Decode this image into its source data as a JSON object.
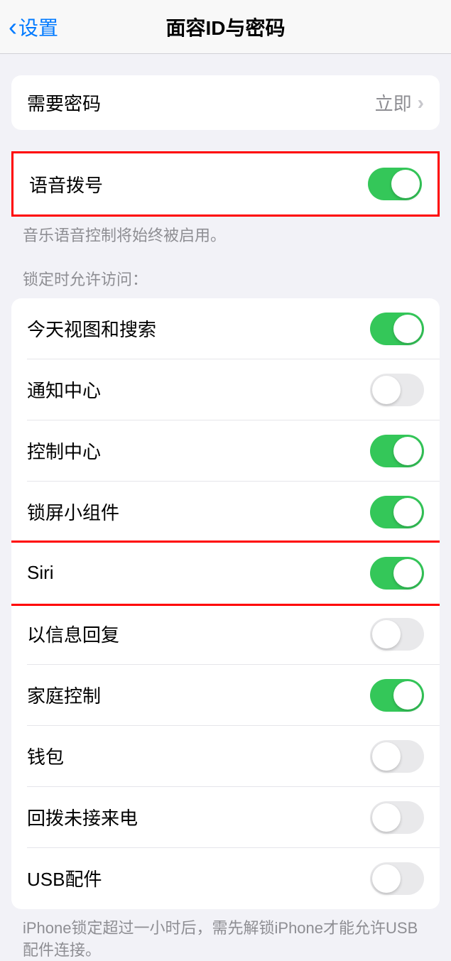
{
  "nav": {
    "back_label": "设置",
    "title": "面容ID与密码"
  },
  "passcode": {
    "require_label": "需要密码",
    "require_value": "立即"
  },
  "voice_dial": {
    "label": "语音拨号",
    "on": true,
    "footer": "音乐语音控制将始终被启用。"
  },
  "lock_access": {
    "header": "锁定时允许访问：",
    "items": [
      {
        "label": "今天视图和搜索",
        "on": true
      },
      {
        "label": "通知中心",
        "on": false
      },
      {
        "label": "控制中心",
        "on": true
      },
      {
        "label": "锁屏小组件",
        "on": true
      },
      {
        "label": "Siri",
        "on": true
      },
      {
        "label": "以信息回复",
        "on": false
      },
      {
        "label": "家庭控制",
        "on": true
      },
      {
        "label": "钱包",
        "on": false
      },
      {
        "label": "回拨未接来电",
        "on": false
      },
      {
        "label": "USB配件",
        "on": false
      }
    ],
    "footer": "iPhone锁定超过一小时后，需先解锁iPhone才能允许USB配件连接。"
  }
}
